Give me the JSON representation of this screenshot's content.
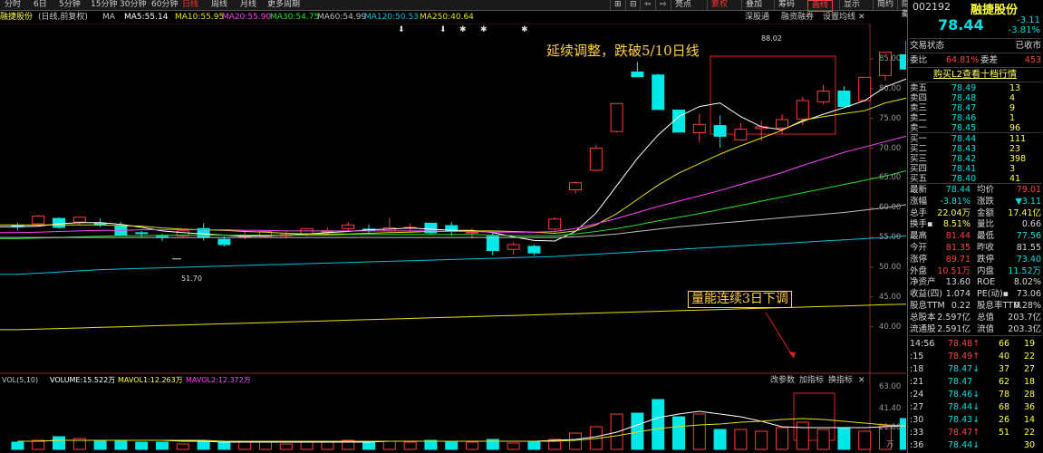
{
  "period_tabs": [
    "分时",
    "6日",
    "5分钟",
    "15分钟",
    "30分钟",
    "60分钟",
    "日线",
    "周线",
    "月线",
    "更多周期"
  ],
  "active_period": "日线",
  "toolbar": {
    "icons": [
      "⊞",
      "⊟",
      "⇦",
      "⇨"
    ],
    "buttons": [
      "亮点",
      "复权",
      "叠加",
      "筹码",
      "画线",
      "显示",
      "简约",
      "隐藏"
    ]
  },
  "chart_header": {
    "stock": "融捷股份",
    "mode": "(日线,前复权)",
    "ma_prefix": "MA",
    "ma_values": [
      {
        "label": "MA5:55.14",
        "color": "#ffffff"
      },
      {
        "label": "MA10:55.95",
        "color": "#e8e000"
      },
      {
        "label": "MA20:55.90",
        "color": "#ff40ff"
      },
      {
        "label": "MA30:54.75",
        "color": "#20e020"
      },
      {
        "label": "MA60:54.99",
        "color": "#c0c0c0"
      },
      {
        "label": "MA120:50.53",
        "color": "#00c0e0"
      },
      {
        "label": "MA250:40.64",
        "color": "#e8e000"
      }
    ]
  },
  "header_links": [
    "深股通",
    "融资融券",
    "设置均线"
  ],
  "annotations": {
    "top": "延续调整，跌破5/10日线",
    "volume": "量能连续3日下调"
  },
  "price_labels": {
    "high": "88.02",
    "low": "51.70"
  },
  "price_axis": [
    "85.00",
    "80.00",
    "75.00",
    "70.00",
    "65.00",
    "60.00",
    "55.00",
    "50.00",
    "45.00",
    "40.00"
  ],
  "volume_axis": [
    "63.00",
    "41.40",
    "21.00",
    "万"
  ],
  "volume_header": {
    "title": "VOL(5,10)",
    "volume": "VOLUME:15.522万",
    "mavol1": "MAVOL1:12.263万",
    "mavol2": "MAVOL2:12.372万"
  },
  "volume_buttons": [
    "改参数",
    "加指标",
    "换指标"
  ],
  "chart_data": {
    "type": "candlestick",
    "ylim": [
      37,
      89
    ],
    "candles": [
      [
        57.0,
        57.5,
        56.2,
        56.8
      ],
      [
        57.3,
        58.8,
        56.9,
        58.6
      ],
      [
        58.2,
        58.4,
        56.5,
        56.7
      ],
      [
        57.6,
        58.4,
        57.2,
        58.4
      ],
      [
        57.4,
        58.2,
        56.7,
        57.1
      ],
      [
        56.9,
        57.6,
        55.4,
        55.4
      ],
      [
        55.8,
        56.1,
        55.1,
        55.7
      ],
      [
        55.2,
        55.6,
        54.4,
        55.0
      ],
      [
        55.3,
        56.3,
        55.0,
        56.1
      ],
      [
        56.5,
        57.4,
        54.5,
        55.0
      ],
      [
        54.7,
        55.2,
        53.5,
        53.8
      ],
      [
        55.1,
        56.2,
        54.7,
        55.2
      ],
      [
        55.2,
        56.2,
        54.9,
        56.0
      ],
      [
        55.3,
        56.0,
        54.8,
        55.5
      ],
      [
        55.6,
        56.6,
        55.2,
        56.5
      ],
      [
        56.0,
        56.6,
        55.3,
        56.1
      ],
      [
        56.5,
        57.6,
        56.0,
        57.1
      ],
      [
        56.4,
        57.2,
        55.8,
        56.2
      ],
      [
        56.1,
        58.3,
        56.0,
        56.6
      ],
      [
        56.7,
        57.3,
        55.9,
        56.7
      ],
      [
        57.4,
        57.4,
        55.6,
        55.8
      ],
      [
        57.0,
        57.6,
        55.3,
        56.0
      ],
      [
        55.8,
        56.5,
        54.8,
        55.9
      ],
      [
        55.2,
        56.1,
        52.0,
        52.8
      ],
      [
        53.0,
        54.2,
        52.1,
        53.8
      ],
      [
        53.5,
        53.8,
        52.0,
        52.4
      ],
      [
        56.4,
        58.4,
        55.8,
        58.1
      ],
      [
        63.0,
        64.4,
        62.4,
        64.2
      ],
      [
        66.3,
        70.6,
        66.1,
        70.0
      ],
      [
        72.8,
        76.8,
        72.6,
        77.5
      ],
      [
        82.8,
        84.5,
        82.0,
        82.0
      ],
      [
        82.3,
        82.5,
        76.5,
        76.5
      ],
      [
        76.4,
        76.4,
        72.7,
        72.7
      ],
      [
        72.6,
        75.8,
        71.0,
        74.0
      ],
      [
        73.8,
        75.5,
        70.1,
        72.0
      ],
      [
        71.4,
        74.2,
        71.3,
        73.2
      ],
      [
        73.3,
        74.6,
        71.2,
        73.6
      ],
      [
        73.4,
        75.7,
        72.4,
        74.8
      ],
      [
        74.9,
        78.6,
        73.9,
        78.0
      ],
      [
        77.8,
        80.6,
        77.4,
        79.6
      ],
      [
        79.6,
        80.4,
        77.0,
        77.0
      ],
      [
        78.0,
        81.7,
        77.8,
        81.9
      ],
      [
        82.2,
        86.2,
        81.3,
        86.1
      ],
      [
        85.7,
        88.0,
        84.8,
        83.3
      ],
      [
        83.1,
        84.3,
        81.0,
        81.2
      ],
      [
        80.8,
        82.3,
        79.8,
        81.8
      ],
      [
        81.4,
        81.6,
        78.4,
        78.4
      ]
    ],
    "ma": [
      {
        "name": "MA5",
        "color": "#ffffff",
        "values": [
          56.8,
          56.9,
          57.3,
          57.5,
          57.5,
          57.2,
          56.7,
          56.1,
          55.8,
          55.6,
          55.4,
          55.2,
          55.3,
          55.4,
          55.6,
          55.8,
          56.0,
          56.3,
          56.4,
          56.6,
          56.4,
          56.2,
          56.2,
          55.8,
          55.1,
          54.5,
          54.4,
          56.0,
          59.1,
          63.7,
          68.3,
          72.2,
          75.3,
          77.0,
          77.6,
          75.3,
          73.6,
          73.1,
          74.5,
          75.7,
          76.8,
          78.0,
          80.3,
          81.6,
          81.9,
          81.9,
          81.5
        ]
      },
      {
        "name": "MA10",
        "color": "#e8e000",
        "values": [
          57.1,
          57.1,
          57.1,
          57.1,
          57.1,
          57.0,
          56.9,
          56.6,
          56.4,
          56.3,
          56.2,
          56.0,
          55.9,
          55.7,
          55.6,
          55.6,
          55.6,
          55.7,
          55.8,
          55.9,
          56.0,
          56.0,
          56.1,
          56.1,
          56.0,
          55.9,
          55.7,
          56.1,
          57.1,
          59.0,
          61.4,
          63.8,
          65.8,
          67.4,
          69.0,
          70.4,
          71.7,
          73.0,
          74.7,
          75.3,
          75.8,
          76.3,
          77.6,
          78.4,
          79.2,
          79.9,
          80.6
        ]
      },
      {
        "name": "MA20",
        "color": "#ff40ff",
        "values": [
          55.8,
          55.9,
          56.0,
          56.1,
          56.2,
          56.2,
          56.3,
          56.3,
          56.3,
          56.3,
          56.3,
          56.2,
          56.2,
          56.1,
          56.1,
          56.1,
          56.1,
          56.1,
          56.1,
          56.1,
          56.1,
          56.0,
          56.0,
          55.9,
          55.9,
          55.9,
          56.0,
          56.5,
          57.3,
          58.2,
          59.2,
          60.2,
          61.1,
          62.0,
          62.9,
          63.9,
          64.9,
          65.9,
          67.1,
          68.2,
          69.3,
          70.2,
          71.1,
          72.0,
          73.4,
          75.3,
          76.4
        ]
      },
      {
        "name": "MA30",
        "color": "#20e020",
        "values": [
          54.8,
          54.9,
          55.0,
          55.1,
          55.2,
          55.3,
          55.3,
          55.4,
          55.4,
          55.4,
          55.4,
          55.4,
          55.4,
          55.4,
          55.4,
          55.4,
          55.5,
          55.5,
          55.5,
          55.5,
          55.5,
          55.5,
          55.5,
          55.4,
          55.3,
          55.3,
          55.3,
          55.6,
          56.0,
          56.5,
          57.1,
          57.8,
          58.4,
          59.0,
          59.7,
          60.4,
          61.1,
          61.8,
          62.5,
          63.2,
          63.9,
          64.6,
          65.3,
          66.2,
          67.0,
          68.0,
          69.9
        ]
      },
      {
        "name": "MA60",
        "color": "#c0c0c0",
        "values": [
          55.0,
          55.0,
          55.0,
          55.0,
          55.0,
          55.0,
          55.0,
          55.0,
          55.0,
          55.0,
          55.0,
          55.0,
          55.0,
          55.0,
          55.0,
          55.0,
          55.0,
          55.0,
          55.0,
          55.0,
          55.0,
          55.0,
          55.0,
          55.0,
          55.0,
          55.0,
          55.0,
          55.1,
          55.3,
          55.6,
          56.0,
          56.4,
          56.8,
          57.1,
          57.4,
          57.7,
          58.0,
          58.3,
          58.6,
          58.9,
          59.2,
          59.6,
          60.0,
          60.5,
          61.0,
          61.6,
          62.9
        ]
      },
      {
        "name": "MA120",
        "color": "#00c0e0",
        "values": [
          48.8,
          49.0,
          49.2,
          49.4,
          49.6,
          49.7,
          49.8,
          49.9,
          50.0,
          50.1,
          50.2,
          50.3,
          50.4,
          50.5,
          50.6,
          50.7,
          50.8,
          50.9,
          51.0,
          51.1,
          51.2,
          51.3,
          51.4,
          51.5,
          51.6,
          51.7,
          51.8,
          52.0,
          52.2,
          52.4,
          52.6,
          52.8,
          53.0,
          53.2,
          53.4,
          53.6,
          53.8,
          54.0,
          54.2,
          54.4,
          54.6,
          54.8,
          55.0,
          55.3,
          55.6,
          56.0,
          57.5
        ]
      },
      {
        "name": "MA250",
        "color": "#e8e000",
        "values": [
          39.5,
          39.6,
          39.7,
          39.8,
          39.9,
          40.0,
          40.1,
          40.2,
          40.3,
          40.4,
          40.5,
          40.6,
          40.7,
          40.8,
          40.9,
          41.0,
          41.1,
          41.2,
          41.3,
          41.4,
          41.5,
          41.6,
          41.7,
          41.8,
          41.9,
          42.0,
          42.1,
          42.2,
          42.3,
          42.4,
          42.5,
          42.6,
          42.7,
          42.8,
          42.9,
          43.0,
          43.1,
          43.2,
          43.3,
          43.4,
          43.5,
          43.6,
          43.7,
          43.8,
          43.9,
          44.1,
          44.8
        ]
      }
    ],
    "volumes": [
      8,
      10,
      14,
      12,
      9,
      9,
      8,
      8,
      6,
      9,
      8,
      9,
      8,
      6,
      8,
      8,
      10,
      8,
      9,
      8,
      10,
      9,
      8,
      11,
      7,
      9,
      11,
      18,
      25,
      39,
      40,
      55,
      36,
      39,
      22,
      22,
      20,
      24,
      30,
      22,
      24,
      20,
      26,
      34,
      20,
      28,
      15.5
    ],
    "vol_ylim": [
      0,
      72
    ],
    "mavol": [
      {
        "name": "MAVOL1",
        "color": "#ffffff",
        "values": [
          9,
          9,
          10,
          10,
          10,
          10,
          10,
          10,
          9,
          9,
          8,
          8,
          8,
          8,
          8,
          8,
          8,
          8,
          9,
          9,
          9,
          9,
          9,
          9,
          9,
          9,
          10,
          11,
          14,
          19,
          27,
          35,
          39,
          42,
          39,
          36,
          31,
          25,
          24,
          24,
          24,
          24,
          25,
          26,
          25,
          24,
          15
        ]
      },
      {
        "name": "MAVOL2",
        "color": "#e8e000",
        "values": [
          9,
          9,
          10,
          10,
          10,
          10,
          10,
          10,
          10,
          10,
          9,
          9,
          9,
          9,
          9,
          9,
          9,
          9,
          9,
          9,
          9,
          9,
          9,
          9,
          9,
          9,
          9,
          10,
          12,
          15,
          19,
          23,
          25,
          27,
          28,
          30,
          31,
          33,
          34,
          33,
          31,
          29,
          27,
          26,
          25,
          24,
          12
        ]
      }
    ]
  },
  "quote": {
    "code": "002192",
    "name": "融捷股份",
    "price": "78.44",
    "change": "-3.11",
    "change_pct": "-3.81%",
    "status_label": "交易状态",
    "status_value": "已收市",
    "wb_label": "委比",
    "wb_value": "64.81%",
    "wc_label": "委差",
    "wc_value": "453",
    "l2_link": "购买L2查看十档行情",
    "asks": [
      [
        "卖五",
        "78.49",
        "13"
      ],
      [
        "卖四",
        "78.48",
        "4"
      ],
      [
        "卖三",
        "78.47",
        "9"
      ],
      [
        "卖二",
        "78.46",
        "1"
      ],
      [
        "卖一",
        "78.45",
        "96"
      ]
    ],
    "bids": [
      [
        "买一",
        "78.44",
        "111"
      ],
      [
        "买二",
        "78.43",
        "23"
      ],
      [
        "买三",
        "78.42",
        "398"
      ],
      [
        "买四",
        "78.41",
        "3"
      ],
      [
        "买五",
        "78.40",
        "41"
      ]
    ],
    "stats": [
      [
        "最新",
        "78.44",
        "均价",
        "79.01"
      ],
      [
        "涨幅",
        "-3.81%",
        "涨跌",
        "▼3.11"
      ],
      [
        "总手",
        "22.04万",
        "金额",
        "17.41亿"
      ],
      [
        "换手▪",
        "8.51%",
        "量比",
        "0.66"
      ],
      [
        "最高",
        "81.44",
        "最低",
        "77.56"
      ],
      [
        "今开",
        "81.35",
        "昨收",
        "81.55"
      ],
      [
        "涨停",
        "89.71",
        "跌停",
        "73.40"
      ],
      [
        "外盘",
        "10.51万",
        "内盘",
        "11.52万"
      ],
      [
        "净资产",
        "13.60",
        "ROE",
        "8.02%"
      ],
      [
        "收益(四)",
        "1.074",
        "PE(动)▪",
        "73.06"
      ],
      [
        "股息TTM",
        "0.22",
        "股息率TTM",
        "0.28%"
      ],
      [
        "总股本",
        "2.597亿",
        "总值",
        "203.7亿"
      ],
      [
        "流通股",
        "2.591亿",
        "流值",
        "203.3亿"
      ]
    ],
    "ticks": [
      [
        "14:56",
        "78.48↑",
        "66",
        "19"
      ],
      [
        ":15",
        "78.49↑",
        "40",
        "22"
      ],
      [
        ":18",
        "78.47↓",
        "37",
        "27"
      ],
      [
        ":21",
        "78.47",
        "62",
        "18"
      ],
      [
        ":24",
        "78.46↓",
        "78",
        "28"
      ],
      [
        ":27",
        "78.44↓",
        "68",
        "36"
      ],
      [
        ":30",
        "78.43↓",
        "26",
        "14"
      ],
      [
        ":33",
        "78.47↑",
        "51",
        "22"
      ],
      [
        ":36",
        "78.44↓",
        "",
        "30"
      ]
    ]
  }
}
